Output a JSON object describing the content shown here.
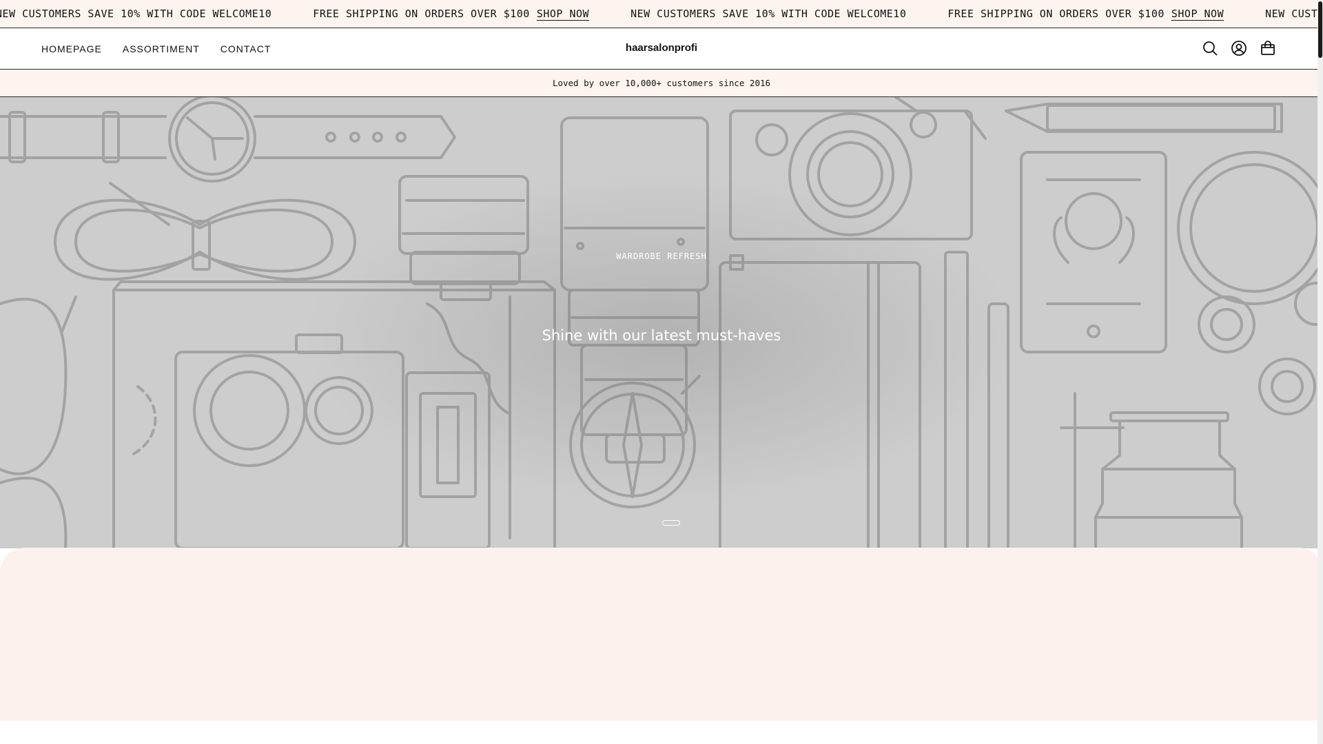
{
  "marquee": {
    "items": [
      {
        "text": "NEW CUSTOMERS SAVE 10% WITH CODE WELCOME10",
        "link": ""
      },
      {
        "text": "FREE SHIPPING ON ORDERS OVER $100",
        "link": "SHOP NOW"
      },
      {
        "text": "NEW CUSTOMERS SAVE 10% WITH CODE WELCOME10",
        "link": ""
      },
      {
        "text": "FREE SHIPPING ON ORDERS OVER $100",
        "link": "SHOP NOW"
      },
      {
        "text": "NEW CUSTOMERS",
        "link": ""
      }
    ]
  },
  "header": {
    "nav": [
      "HOMEPAGE",
      "ASSORTIMENT",
      "CONTACT"
    ],
    "logo": "haarsalonprofi",
    "icons": [
      "search-icon",
      "account-icon",
      "cart-icon"
    ]
  },
  "announcement": "Loved by over 10,000+ customers since 2016",
  "hero": {
    "eyebrow": "WARDROBE REFRESH",
    "title": "Shine with our latest must-haves",
    "slide_count": 1
  },
  "colors": {
    "cream": "#fdf4ef",
    "hero_bg": "#cdcdcd",
    "line": "#a3a3a3",
    "text": "#111111"
  }
}
